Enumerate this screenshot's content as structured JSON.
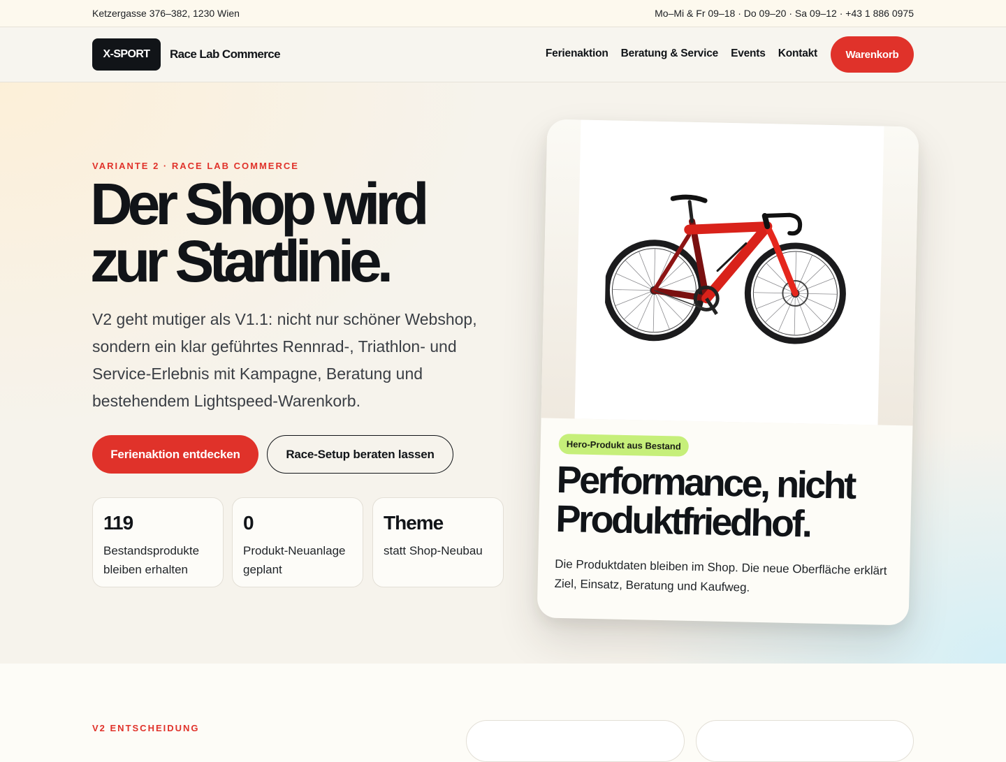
{
  "topbar": {
    "address": "Ketzergasse 376–382, 1230 Wien",
    "hours": "Mo–Mi & Fr 09–18 · Do 09–20 · Sa 09–12 · +43 1 886 0975"
  },
  "header": {
    "logo": "X-SPORT",
    "brand": "Race Lab Commerce",
    "nav": [
      "Ferienaktion",
      "Beratung & Service",
      "Events",
      "Kontakt"
    ],
    "cart": "Warenkorb"
  },
  "hero": {
    "kicker": "VARIANTE 2 · RACE LAB COMMERCE",
    "headline_line1": "Der Shop wird",
    "headline_line2": "zur Startlinie.",
    "lead": "V2 geht mutiger als V1.1: nicht nur schöner Webshop, sondern ein klar geführtes Rennrad-, Triathlon- und Service-Erlebnis mit Kampagne, Beratung und bestehendem Lightspeed-Warenkorb.",
    "primary_cta": "Ferienaktion entdecken",
    "secondary_cta": "Race-Setup beraten lassen",
    "stats": [
      {
        "value": "119",
        "label": "Bestandsprodukte bleiben erhalten"
      },
      {
        "value": "0",
        "label": "Produkt-Neuanlage geplant"
      },
      {
        "value": "Theme",
        "label": "statt Shop-Neubau"
      }
    ]
  },
  "card": {
    "badge": "Hero-Produkt aus Bestand",
    "title_line1": "Performance, nicht",
    "title_line2": "Produktfriedhof.",
    "text": "Die Produktdaten bleiben im Shop. Die neue Oberfläche erklärt Ziel, Einsatz, Beratung und Kaufweg.",
    "image_icon": "road-bike-image"
  },
  "next_section": {
    "kicker": "V2 ENTSCHEIDUNG"
  },
  "colors": {
    "accent": "#e0322a",
    "ink": "#111418",
    "badge": "#c6ef7a"
  }
}
